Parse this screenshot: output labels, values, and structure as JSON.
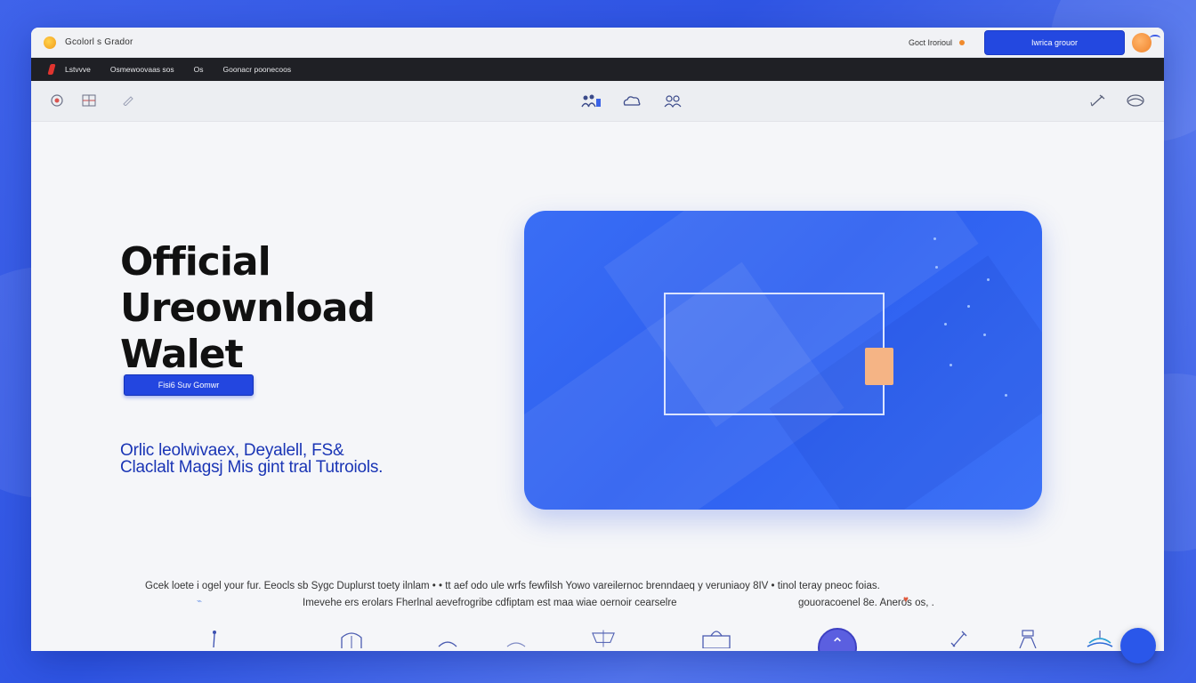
{
  "titlebar": {
    "site_name": "Gcolorl s Grador",
    "signin_label": "Goct Irorioul",
    "cta_label": "Iwrica grouor"
  },
  "navbar": {
    "items": [
      "Lstvvve",
      "Osmewoovaas sos",
      "Os",
      "Goonacr poonecoos"
    ]
  },
  "toolbar": {
    "left_icons": [
      "target-icon",
      "grid-icon",
      "pen-icon"
    ],
    "center_icons": [
      "team-icon",
      "cloud-icon",
      "users-icon"
    ],
    "right_icons": [
      "edit-icon",
      "globe-icon"
    ]
  },
  "hero": {
    "title_line1": "Official",
    "title_line2": "Ureownload",
    "title_line3": "Walet",
    "button_label": "Fisi6 Suv Gomwr",
    "subtitle_line1": "Orlic leolwivaex,  Deyalell, FS&",
    "subtitle_line2": "Claclalt Magsj Mis gint tral Tutroiols."
  },
  "footer_text": {
    "line1": "Gcek loete i ogel your  fur.  Eeocls sb Sygc Duplurst toety ilnlam  • •   tt aef odo ule wrfs fewfilsh  Yowo vareilernoc  brenndaeq y veruniaoy 8IV    •   tinol teray pneoc foias.",
    "line2a": "Imevehe ers erolars Fherlnal aevefrogribe cdfiptam est maa wiae oernoir cearselre",
    "line2b": "gouoracoenel 8e.              Aneros os,  ."
  },
  "bottom_bar": {
    "icons": [
      "pin-icon",
      "home-icon",
      "headset-icon",
      "cup-icon",
      "chart-icon",
      "bag-icon",
      "up-arrow-icon",
      "tool-icon",
      "person-icon",
      "ship-icon"
    ]
  },
  "colors": {
    "accent": "#2348e0",
    "card_blue": "#2d5ff0",
    "nav_dark": "#1f2025",
    "subtitle_blue": "#1a35b5"
  }
}
